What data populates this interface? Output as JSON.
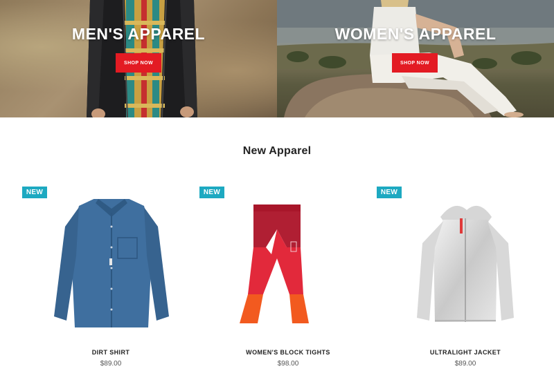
{
  "hero": {
    "men": {
      "title": "MEN'S APPAREL",
      "button_label": "SHOP NOW"
    },
    "women": {
      "title": "WOMEN'S APPAREL",
      "button_label": "SHOP NOW"
    }
  },
  "section": {
    "title": "New Apparel"
  },
  "products": [
    {
      "badge": "NEW",
      "name": "DIRT SHIRT",
      "price": "$89.00",
      "image_icon": "blue-shirt"
    },
    {
      "badge": "NEW",
      "name": "WOMEN'S BLOCK TIGHTS",
      "price": "$98.00",
      "image_icon": "red-tights"
    },
    {
      "badge": "NEW",
      "name": "ULTRALIGHT JACKET",
      "price": "$89.00",
      "image_icon": "silver-jacket"
    }
  ],
  "colors": {
    "accent_red": "#e31b23",
    "badge_teal": "#1da9c1"
  }
}
